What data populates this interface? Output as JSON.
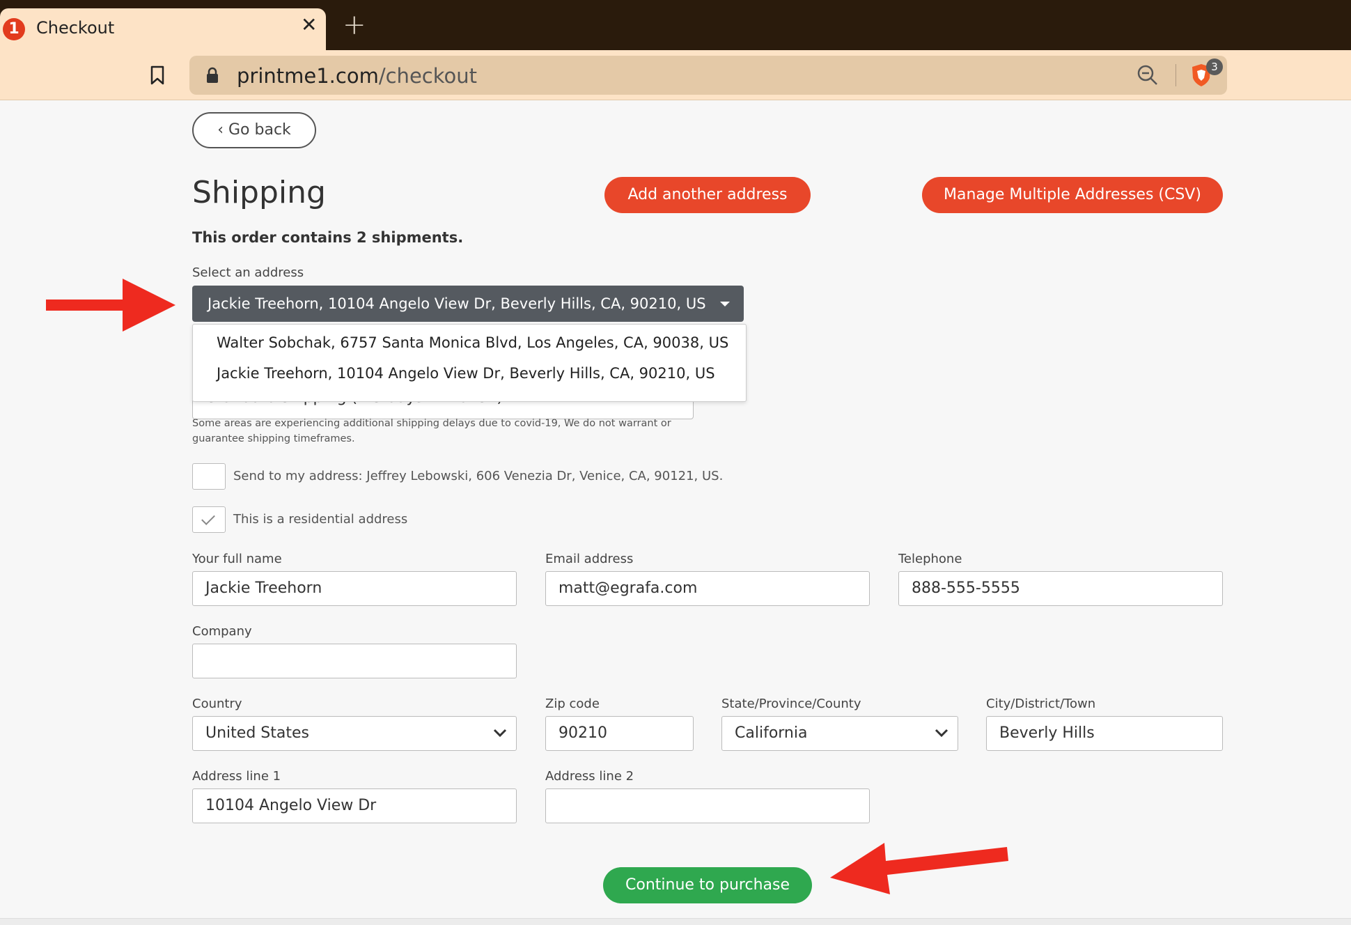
{
  "browser": {
    "tab_title": "Checkout",
    "tab_favicon": "1",
    "close_glyph": "✕",
    "new_tab_glyph": "+",
    "url_host": "printme1.com",
    "url_path": "/checkout",
    "shields_badge": "3"
  },
  "page": {
    "go_back_label": "Go back",
    "go_back_icon": "chevron-left-icon",
    "title": "Shipping",
    "add_address_label": "Add another address",
    "manage_csv_label": "Manage Multiple Addresses (CSV)",
    "shipments_text": "This order contains 2 shipments.",
    "select_address_label": "Select an address",
    "selected_address": "Jackie Treehorn, 10104 Angelo View Dr, Beverly Hills, CA, 90210, US",
    "address_options": [
      "Walter Sobchak, 6757 Santa Monica Blvd, Los Angeles, CA, 90038, US",
      "Jackie Treehorn, 10104 Angelo View Dr, Beverly Hills, CA, 90210, US"
    ],
    "shipping_method": "Standard shipping (4-5 days in transit)",
    "covid_note": "Some areas are experiencing additional shipping delays due to covid-19, We do not warrant or guarantee shipping timeframes.",
    "send_to_my_address_label": "Send to my address: Jeffrey Lebowski, 606 Venezia Dr, Venice, CA, 90121, US.",
    "send_to_my_address_checked": false,
    "residential_label": "This is a residential address",
    "residential_checked": true,
    "form": {
      "full_name_label": "Your full name",
      "full_name_value": "Jackie Treehorn",
      "email_label": "Email address",
      "email_value": "matt@egrafa.com",
      "telephone_label": "Telephone",
      "telephone_value": "888-555-5555",
      "company_label": "Company",
      "company_value": "",
      "country_label": "Country",
      "country_value": "United States",
      "zip_label": "Zip code",
      "zip_value": "90210",
      "state_label": "State/Province/County",
      "state_value": "California",
      "city_label": "City/District/Town",
      "city_value": "Beverly Hills",
      "address1_label": "Address line 1",
      "address1_value": "10104 Angelo View Dr",
      "address2_label": "Address line 2",
      "address2_value": ""
    },
    "continue_label": "Continue to purchase"
  },
  "colors": {
    "accent_orange": "#e8472a",
    "accent_green": "#2fa84f",
    "annotation_red": "#ee2a1f",
    "chrome_bg": "#fde3c6",
    "select_bg": "#555a60"
  }
}
